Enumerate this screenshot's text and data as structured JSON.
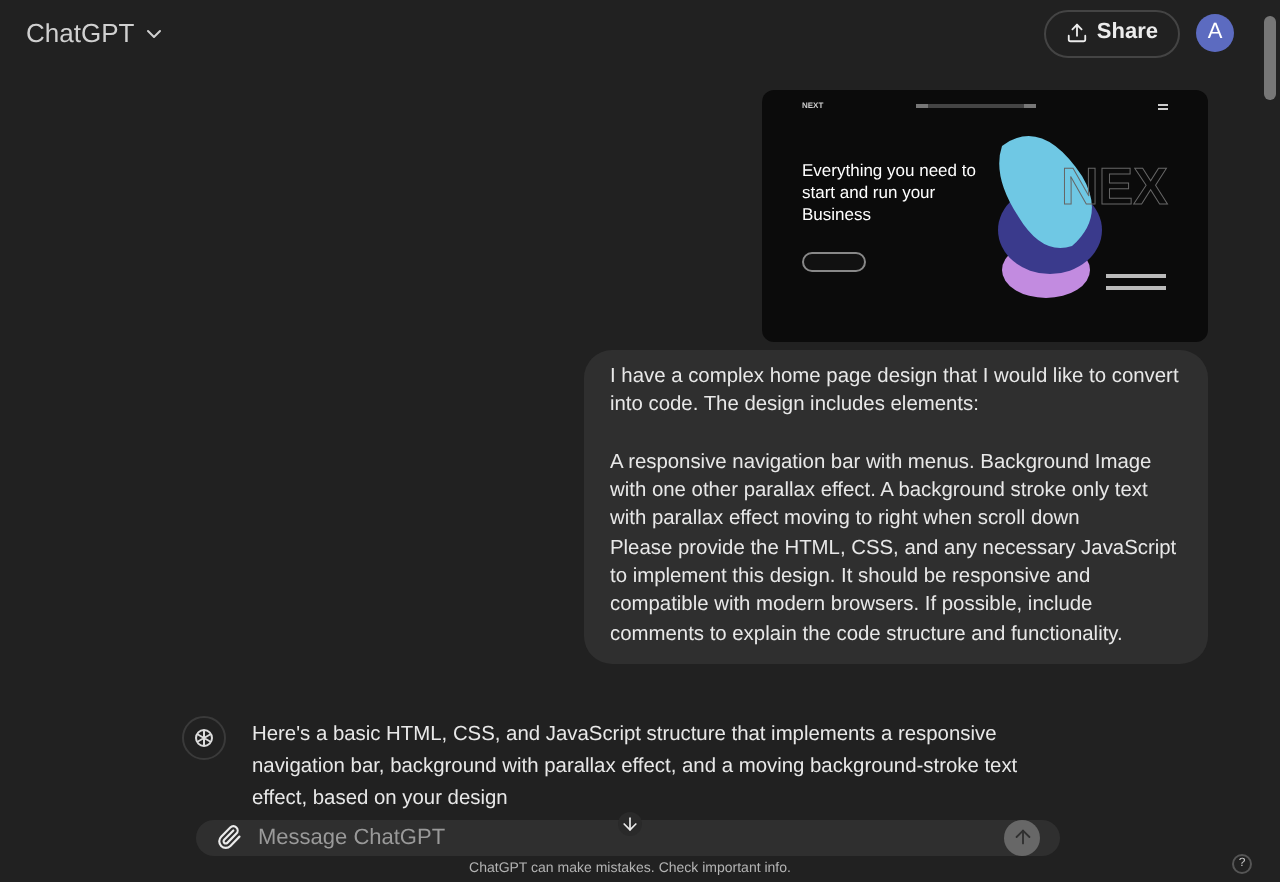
{
  "header": {
    "model": "ChatGPT",
    "share": "Share",
    "avatar": "A"
  },
  "attachment": {
    "logo": "NEXT",
    "headline": "Everything you need to start and run your Business",
    "outline_text": "NEX"
  },
  "user_message": [
    [
      "I have a complex home page design that I would like to convert into code. The design includes elements:"
    ],
    [
      "A responsive navigation bar with menus. Background Image with one other parallax effect. A background stroke only text with parallax effect moving to right when scroll down",
      "Please provide the HTML, CSS, and any necessary JavaScript to implement this design. It should be responsive and compatible with modern browsers. If possible, include comments to explain the code structure and functionality."
    ]
  ],
  "assistant_message": "Here's a basic HTML, CSS, and JavaScript structure that implements a responsive navigation bar, background with parallax effect, and a moving background-stroke text effect, based on your design",
  "composer": {
    "placeholder": "Message ChatGPT",
    "disabled": true
  },
  "footer": "ChatGPT can make mistakes. Check important info.",
  "help": "?"
}
